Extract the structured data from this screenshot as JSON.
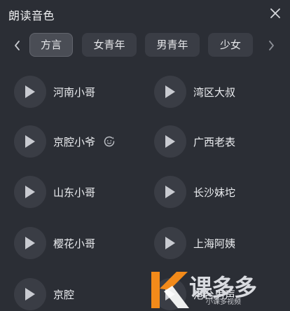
{
  "header": {
    "title": "朗读音色"
  },
  "tabs": [
    {
      "label": "方言",
      "active": true
    },
    {
      "label": "女青年",
      "active": false
    },
    {
      "label": "男青年",
      "active": false
    },
    {
      "label": "少女",
      "active": false
    }
  ],
  "voices": [
    {
      "name": "河南小哥"
    },
    {
      "name": "湾区大叔"
    },
    {
      "name": "京腔小爷"
    },
    {
      "name": "广西老表"
    },
    {
      "name": "山东小哥"
    },
    {
      "name": "长沙妹坨"
    },
    {
      "name": "樱花小哥"
    },
    {
      "name": "上海阿姨"
    },
    {
      "name": "京腔"
    },
    {
      "name": "港台男声"
    }
  ],
  "watermark": {
    "brand": "课多多",
    "sub": "小课多视频"
  },
  "colors": {
    "background": "#2b2e35",
    "button": "#3a3d45",
    "active_tab": "#4a4d55",
    "watermark_orange": "#f28a1a"
  }
}
